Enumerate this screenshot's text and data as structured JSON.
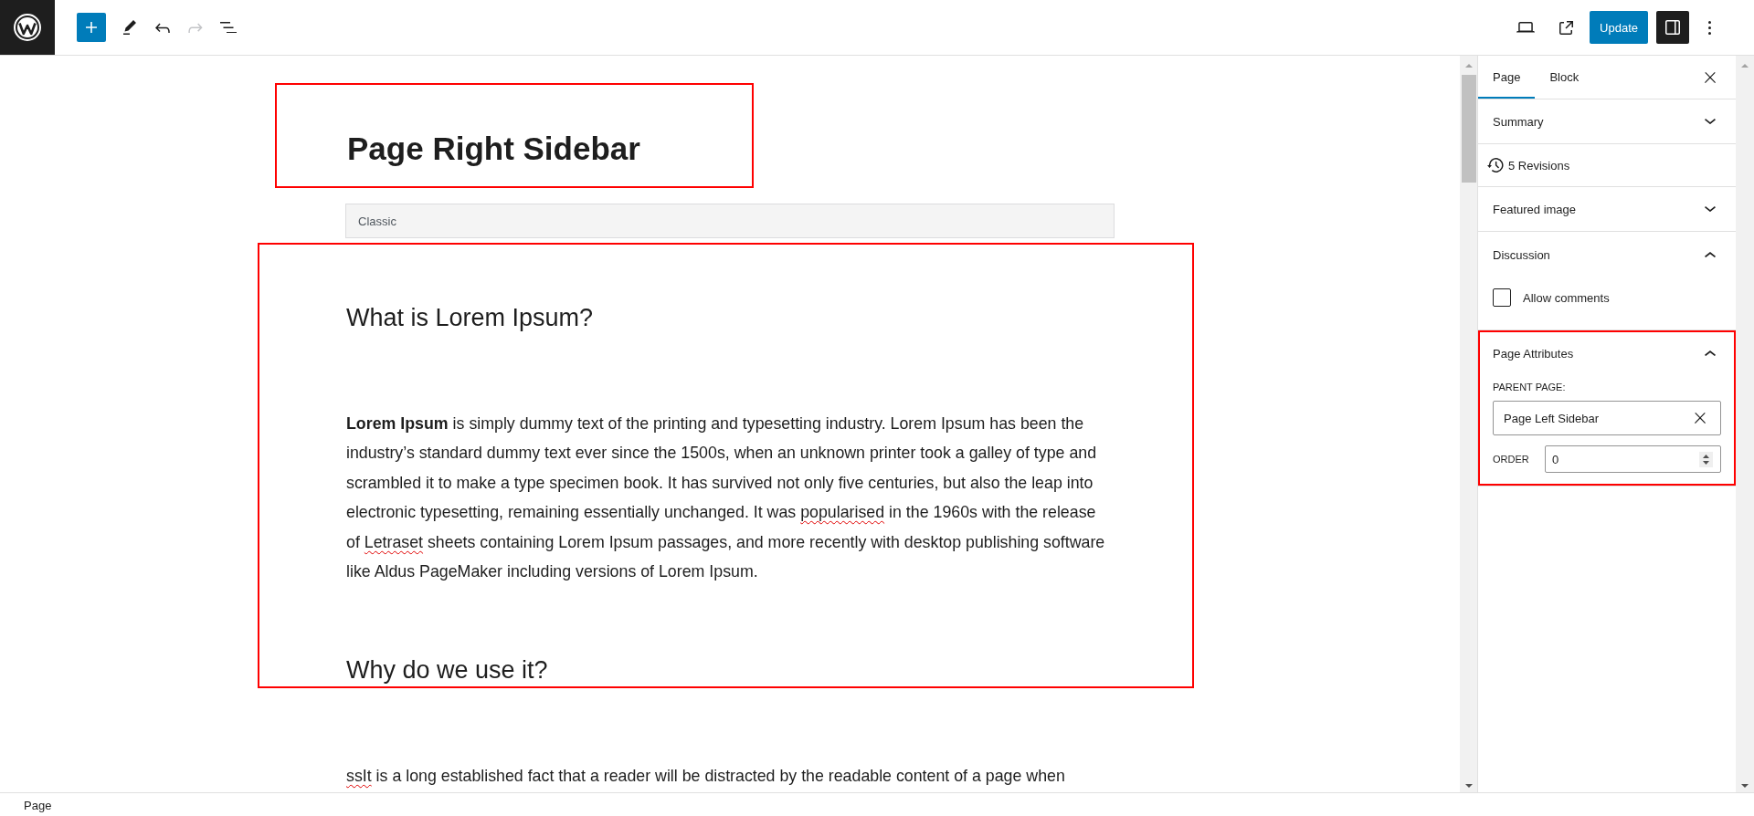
{
  "header": {
    "undo": {
      "disabled": false
    },
    "redo": {
      "disabled": true
    },
    "update_button": "Update",
    "settings_toggle": {
      "on": true
    }
  },
  "editor": {
    "title": {
      "text": "Page Right Sidebar",
      "highlighted": true
    },
    "classic_block": {
      "label": "Classic"
    },
    "sections": [
      {
        "highlighted": true,
        "blocks": [
          {
            "kind": "heading",
            "text": "What is Lorem Ipsum?"
          },
          {
            "kind": "paragraph",
            "runs": [
              {
                "text": "**Lorem Ipsum** is simply dummy text of the printing and typesetting industry. Lorem Ipsum has been the industry’s standard dummy text ever since the 1500s, when an unknown printer took a galley of type and scrambled it to make a type specimen book. It has survived not only five centuries, but also the leap into electronic typesetting, remaining essentially unchanged. It was ",
                "misspelled": false
              },
              {
                "text": "popularised",
                "misspelled": true
              },
              {
                "text": " in the 1960s with the release of ",
                "misspelled": false
              },
              {
                "text": "Letraset",
                "misspelled": true
              },
              {
                "text": " sheets containing Lorem Ipsum passages, and more recently with desktop publishing software like Aldus PageMaker including versions of Lorem Ipsum.",
                "misspelled": false
              }
            ]
          },
          {
            "kind": "heading",
            "text": "Why do we use it?"
          }
        ]
      },
      {
        "highlighted": false,
        "blocks": [
          {
            "kind": "paragraph",
            "runs": [
              {
                "text": "ssIt",
                "misspelled": true
              },
              {
                "text": " is a long established fact that a reader will be distracted by the readable content of a page when",
                "misspelled": false
              }
            ]
          }
        ]
      }
    ]
  },
  "sidebar": {
    "tabs": [
      {
        "label": "Page",
        "selected": true
      },
      {
        "label": "Block",
        "selected": false
      }
    ],
    "panels": [
      {
        "kind": "section",
        "title": "Summary",
        "expanded": false
      },
      {
        "kind": "revisions",
        "label": "5 Revisions"
      },
      {
        "kind": "section",
        "title": "Featured image",
        "expanded": false
      },
      {
        "kind": "discussion",
        "title": "Discussion",
        "expanded": true,
        "checkbox": {
          "label": "Allow comments",
          "checked": false
        }
      },
      {
        "kind": "attributes",
        "title": "Page Attributes",
        "expanded": true,
        "highlighted": true,
        "parent_page": {
          "label": "PARENT PAGE:",
          "value": "Page Left Sidebar"
        },
        "order": {
          "label": "ORDER",
          "value": "0"
        }
      }
    ]
  },
  "status_bar": {
    "breadcrumb": "Page"
  }
}
